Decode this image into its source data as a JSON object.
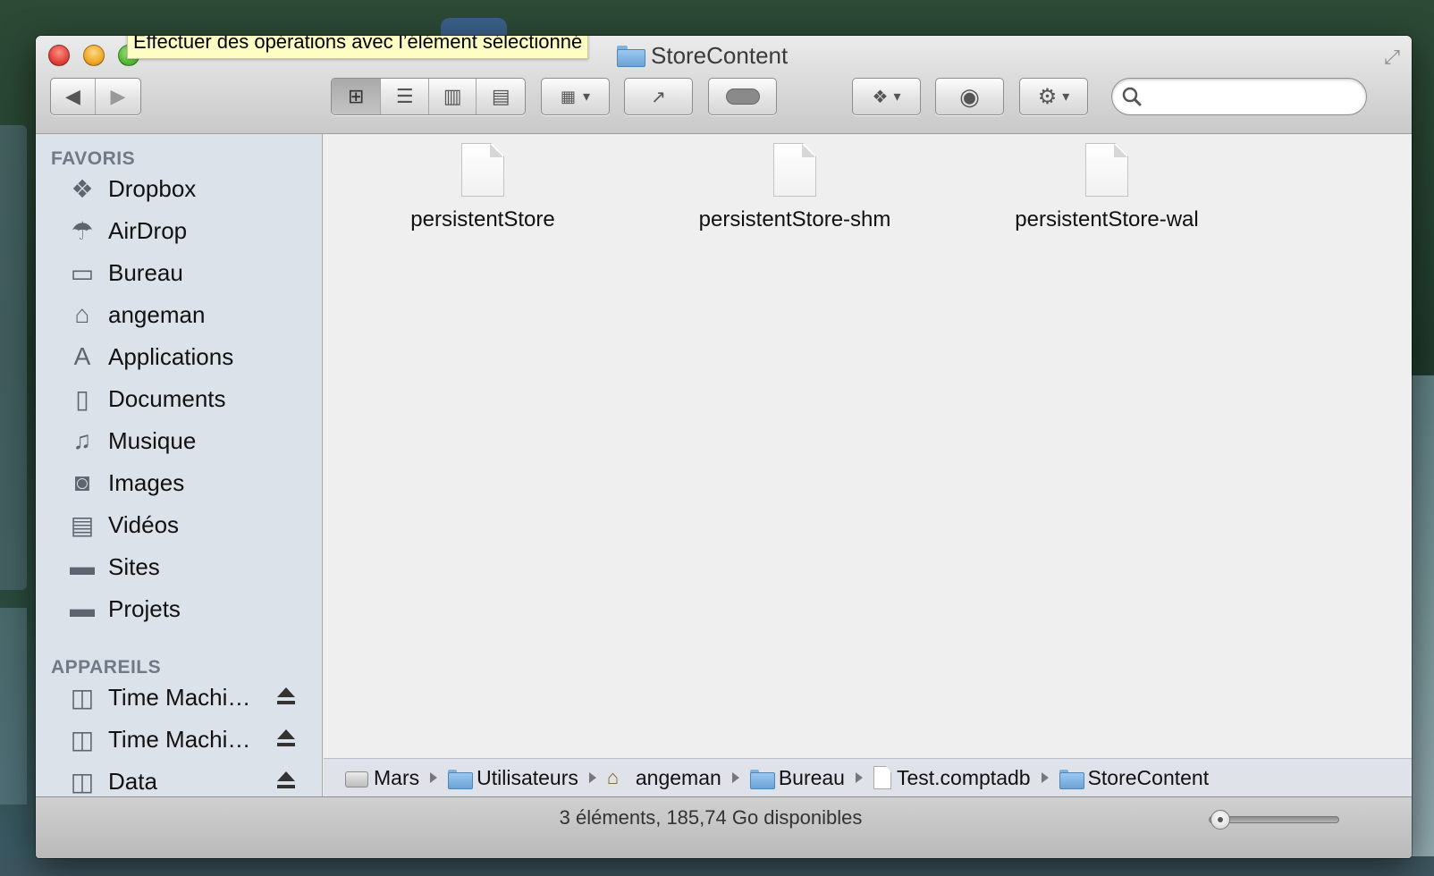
{
  "tooltip": "Effectuer des opérations avec l’élément sélectionné",
  "window": {
    "title": "StoreContent"
  },
  "toolbar": {
    "back": "◀",
    "forward": "▶",
    "view_icon": "⊞",
    "view_list": "☰",
    "view_columns": "▥",
    "view_coverflow": "▤",
    "arrange": "▾",
    "share": "↗",
    "tags": "◐",
    "dropbox": "▾",
    "quicklook": "◉",
    "action": "⚙",
    "action_arrow": "▾"
  },
  "search": {
    "value": "",
    "placeholder": ""
  },
  "sidebar": {
    "favorites_heading": "FAVORIS",
    "favorites": [
      {
        "label": "Dropbox",
        "icon": "dropbox-icon"
      },
      {
        "label": "AirDrop",
        "icon": "airdrop-icon"
      },
      {
        "label": "Bureau",
        "icon": "desktop-icon"
      },
      {
        "label": "angeman",
        "icon": "home-icon"
      },
      {
        "label": "Applications",
        "icon": "applications-icon"
      },
      {
        "label": "Documents",
        "icon": "documents-icon"
      },
      {
        "label": "Musique",
        "icon": "music-icon"
      },
      {
        "label": "Images",
        "icon": "camera-icon"
      },
      {
        "label": "Vidéos",
        "icon": "film-icon"
      },
      {
        "label": "Sites",
        "icon": "folder-icon"
      },
      {
        "label": "Projets",
        "icon": "folder-icon"
      }
    ],
    "devices_heading": "APPAREILS",
    "devices": [
      {
        "label": "Time Machi…",
        "icon": "drive-icon"
      },
      {
        "label": "Time Machi…",
        "icon": "drive-icon"
      },
      {
        "label": "Data",
        "icon": "drive-icon"
      }
    ]
  },
  "files": [
    {
      "name": "persistentStore"
    },
    {
      "name": "persistentStore-shm"
    },
    {
      "name": "persistentStore-wal"
    }
  ],
  "pathbar": [
    "Mars",
    "Utilisateurs",
    "angeman",
    "Bureau",
    "Test.comptadb",
    "StoreContent"
  ],
  "status": {
    "text": "3 éléments, 185,74 Go disponibles",
    "icon_size": 0.1
  },
  "colors": {
    "sidebar_bg": "#dce2ea",
    "content_bg": "#efefef",
    "tooltip_bg": "#fefec4"
  }
}
